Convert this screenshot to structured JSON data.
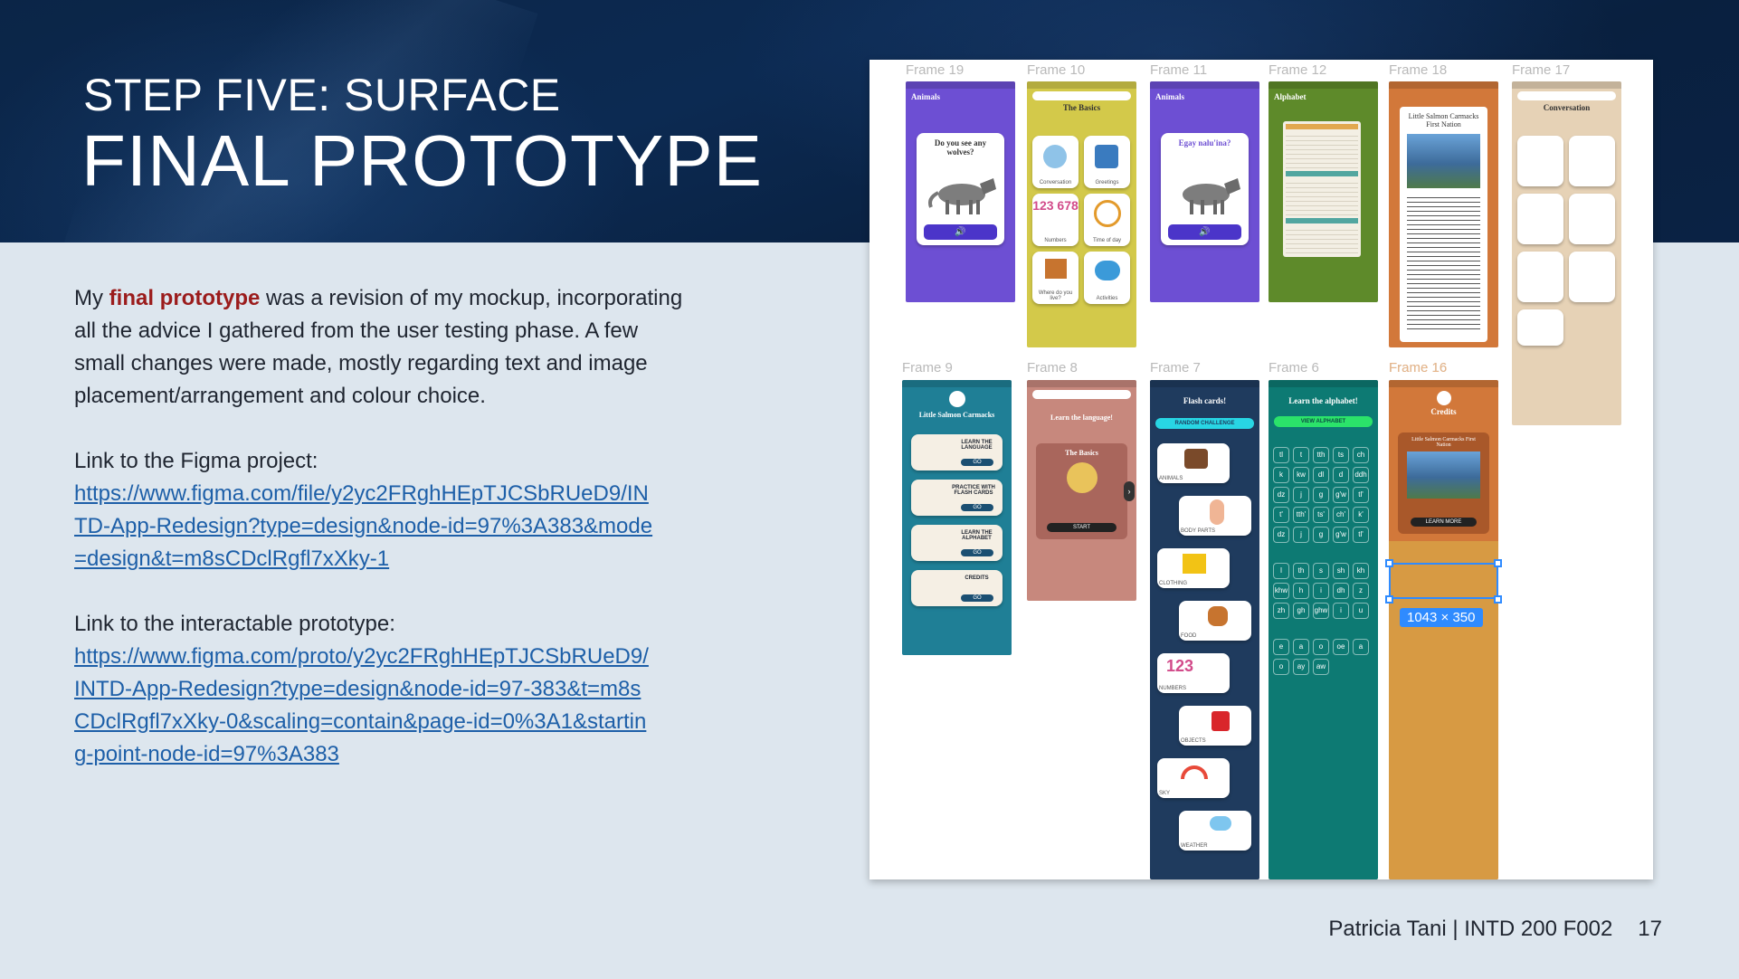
{
  "slide": {
    "subtitle": "STEP FIVE: SURFACE",
    "title": "FINAL PROTOTYPE",
    "intro_prefix": "My ",
    "intro_highlight": "final prototype",
    "intro_rest": " was a revision of my mockup, incorporating all the advice I gathered from the user testing phase. A few small changes were made, mostly regarding text and image placement/arrangement and colour choice.",
    "figma_label": "Link to the Figma project:",
    "figma_url": "https://www.figma.com/file/y2yc2FRghHEpTJCSbRUeD9/INTD-App-Redesign?type=design&node-id=97%3A383&mode=design&t=m8sCDclRgfl7xXky-1",
    "proto_label": "Link to the interactable prototype:",
    "proto_url": "https://www.figma.com/proto/y2yc2FRghHEpTJCSbRUeD9/INTD-App-Redesign?type=design&node-id=97-383&t=m8sCDclRgfl7xXky-0&scaling=contain&page-id=0%3A1&starting-point-node-id=97%3A383",
    "footer_author": "Patricia Tani | INTD 200 F002",
    "page_number": "17"
  },
  "canvas": {
    "frames": {
      "f19": "Frame 19",
      "f10": "Frame 10",
      "f11": "Frame 11",
      "f12": "Frame 12",
      "f18": "Frame 18",
      "f17": "Frame 17",
      "f9": "Frame 9",
      "f8": "Frame 8",
      "f7": "Frame 7",
      "f6": "Frame 6",
      "f16": "Frame 16"
    },
    "screens": {
      "animals": "Animals",
      "wolf_question": "Do you see any wolves?",
      "wolf_question_native": "Egay nalu'ina?",
      "basics": "The Basics",
      "alphabet": "Alphabet",
      "first_nation": "Little Salmon Carmacks First Nation",
      "conversation": "Conversation",
      "home_title": "Little Salmon Carmacks",
      "learn_language": "LEARN THE LANGUAGE",
      "practice_cards": "PRACTICE WITH FLASH CARDS",
      "learn_alphabet": "LEARN THE ALPHABET",
      "credits_btn": "CREDITS",
      "go": "GO",
      "learn_the_language": "Learn the language!",
      "start": "START",
      "flash_cards": "Flash cards!",
      "random_challenge": "RANDOM CHALLENGE",
      "learn_the_alphabet": "Learn the alphabet!",
      "view_alphabet": "VIEW ALPHABET",
      "credits": "Credits",
      "learn_more": "LEARN MORE",
      "basics_tiles": [
        "Conversation",
        "Greetings",
        "Numbers",
        "Time of day",
        "Where do you live?",
        "Activities"
      ],
      "flash_tiles": [
        "ANIMALS",
        "BODY PARTS",
        "CLOTHING",
        "FOOD",
        "NUMBERS",
        "OBJECTS",
        "SKY",
        "WEATHER"
      ],
      "numbers_glyph": "123 678",
      "numbers_card": "123",
      "alphabet_cells": [
        "tl",
        "t",
        "tth",
        "ts",
        "ch",
        "k",
        "kw",
        "dl",
        "d",
        "ddh",
        "dz",
        "j",
        "g",
        "g'w",
        "tl'",
        "t'",
        "tth'",
        "ts'",
        "ch'",
        "k'",
        "dz",
        "j",
        "g",
        "g'w",
        "tl'",
        "l",
        "th",
        "s",
        "sh",
        "kh",
        "khw",
        "h",
        "i",
        "dh",
        "z",
        "zh",
        "gh",
        "ghw",
        "i",
        "u",
        "e",
        "a",
        "o",
        "oe",
        "a",
        "o",
        "ay",
        "aw"
      ]
    },
    "selection_size": "1043 × 350"
  },
  "colors": {
    "header_bg": "#0b2547",
    "body_bg": "#dde6ee",
    "highlight": "#9b1c1c",
    "link": "#1d5fa8",
    "selection": "#2f8bff"
  }
}
